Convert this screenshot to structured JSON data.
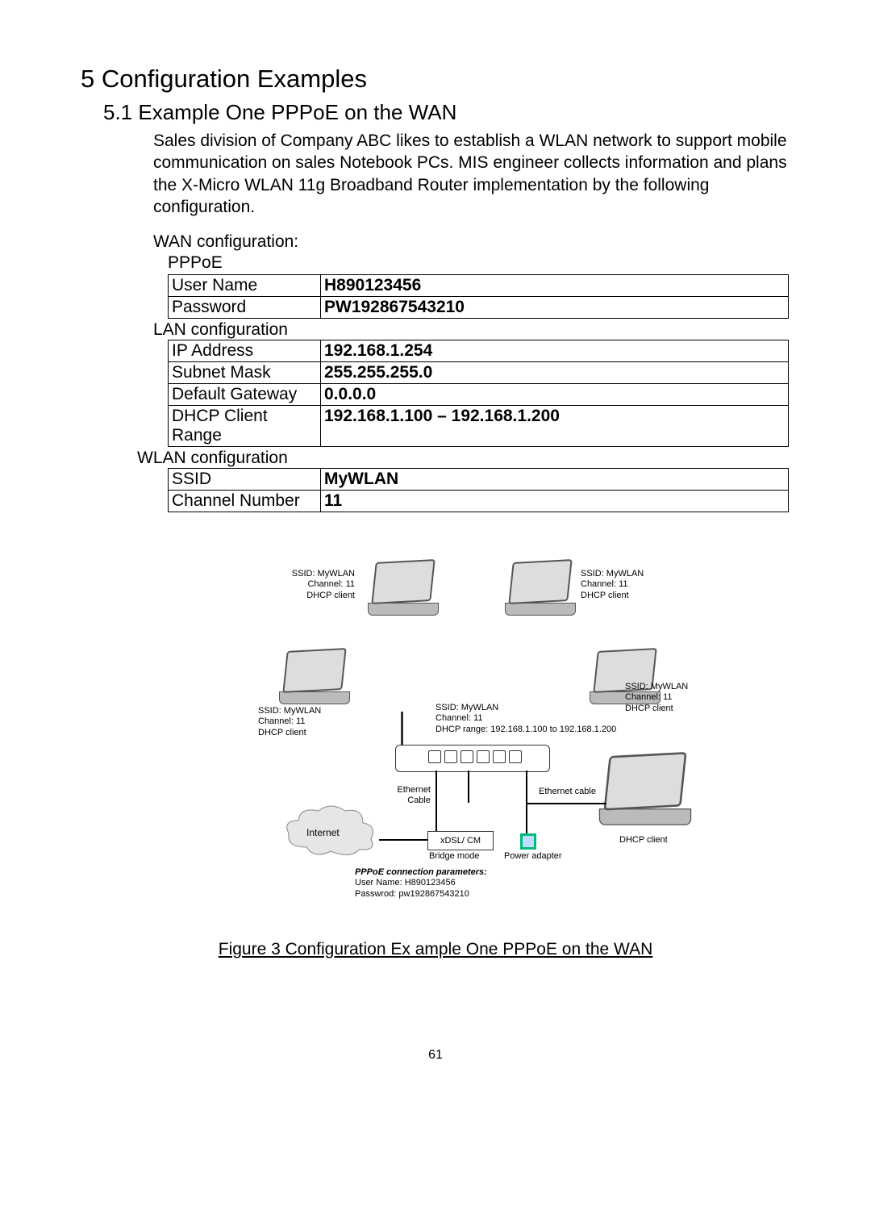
{
  "heading": "5 Configuration Examples",
  "subheading": "5.1 Example One   PPPoE on the WAN",
  "intro": "Sales division of Company ABC likes to establish a WLAN network to support mobile communication on sales  Notebook PCs. MIS engineer collects information and plans the X-Micro WLAN 11g Broadband Router implementation by the following configuration.",
  "wan_label": "WAN configuration:",
  "pppoe_label": "PPPoE",
  "wan": [
    {
      "k": "User Name",
      "v": "H890123456"
    },
    {
      "k": "Password",
      "v": "PW192867543210"
    }
  ],
  "lan_label": "LAN configuration",
  "lan": [
    {
      "k": "IP Address",
      "v": "192.168.1.254"
    },
    {
      "k": "Subnet Mask",
      "v": "255.255.255.0"
    },
    {
      "k": "Default Gateway",
      "v": "0.0.0.0"
    },
    {
      "k": "DHCP Client Range",
      "v": "192.168.1.100 – 192.168.1.200"
    }
  ],
  "wlan_label": "WLAN configuration",
  "wlan": [
    {
      "k": "SSID",
      "v": "MyWLAN"
    },
    {
      "k": "Channel Number",
      "v": "11"
    }
  ],
  "diagram": {
    "client_caption": "SSID: MyWLAN\nChannel: 11\nDHCP client",
    "router_caption": "SSID: MyWLAN\nChannel: 11\nDHCP range: 192.168.1.100 to 192.168.1.200",
    "ethernet_cable": "Ethernet\nCable",
    "ethernet_cable2": "Ethernet cable",
    "power": "Power adapter",
    "xdsl": "xDSL/ CM",
    "bridge": "Bridge mode",
    "internet": "Internet",
    "dhcp_only": "DHCP client",
    "pppoe_title": "PPPoE connection parameters:",
    "pppoe_user": "User Name: H890123456",
    "pppoe_pass": "Passwrod: pw192867543210"
  },
  "figure_caption": "Figure 3   Configuration Ex ample One   PPPoE on the WAN",
  "page_number": "61"
}
